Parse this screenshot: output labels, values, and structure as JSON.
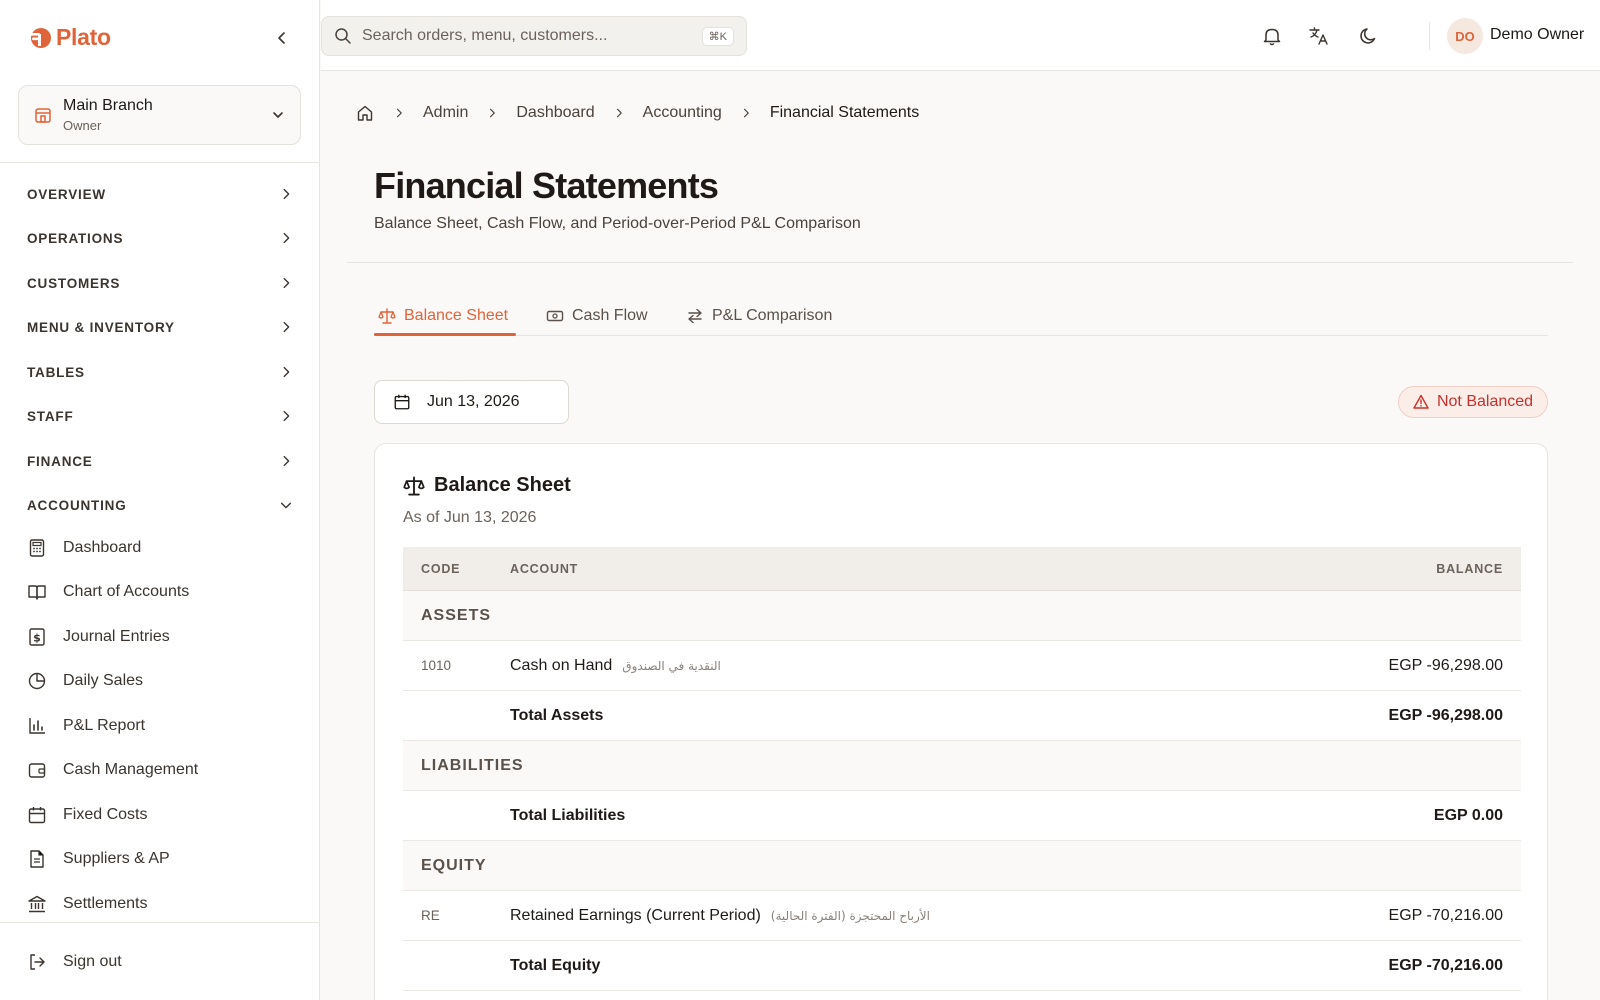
{
  "app": {
    "name": "Plato"
  },
  "branch": {
    "name": "Main Branch",
    "role": "Owner"
  },
  "sidebar": {
    "sections": [
      {
        "label": "OVERVIEW"
      },
      {
        "label": "OPERATIONS"
      },
      {
        "label": "CUSTOMERS"
      },
      {
        "label": "MENU & INVENTORY"
      },
      {
        "label": "TABLES"
      },
      {
        "label": "STAFF"
      },
      {
        "label": "FINANCE"
      },
      {
        "label": "ACCOUNTING",
        "expanded": true
      }
    ],
    "accounting_items": [
      {
        "label": "Dashboard",
        "icon": "calculator-icon"
      },
      {
        "label": "Chart of Accounts",
        "icon": "book-icon"
      },
      {
        "label": "Journal Entries",
        "icon": "dollar-doc-icon"
      },
      {
        "label": "Daily Sales",
        "icon": "pie-chart-icon"
      },
      {
        "label": "P&L Report",
        "icon": "bar-chart-icon"
      },
      {
        "label": "Cash Management",
        "icon": "wallet-icon"
      },
      {
        "label": "Fixed Costs",
        "icon": "calendar-icon"
      },
      {
        "label": "Suppliers & AP",
        "icon": "document-icon"
      },
      {
        "label": "Settlements",
        "icon": "bank-icon"
      }
    ],
    "signout": "Sign out"
  },
  "topbar": {
    "search_placeholder": "Search orders, menu, customers...",
    "shortcut": "⌘K",
    "user_initials": "DO",
    "user_name": "Demo Owner"
  },
  "breadcrumb": {
    "items": [
      "Admin",
      "Dashboard",
      "Accounting"
    ],
    "current": "Financial Statements"
  },
  "page": {
    "title": "Financial Statements",
    "subtitle": "Balance Sheet, Cash Flow, and Period-over-Period P&L Comparison"
  },
  "tabs": [
    {
      "label": "Balance Sheet",
      "active": true
    },
    {
      "label": "Cash Flow"
    },
    {
      "label": "P&L Comparison"
    }
  ],
  "date_picker": {
    "value": "Jun 13, 2026"
  },
  "status": {
    "label": "Not Balanced",
    "color": "#c9302c"
  },
  "card": {
    "title": "Balance Sheet",
    "subtitle": "As of Jun 13, 2026"
  },
  "table": {
    "columns": [
      "CODE",
      "ACCOUNT",
      "BALANCE"
    ],
    "assets": {
      "label": "ASSETS",
      "rows": [
        {
          "code": "1010",
          "account": "Cash on Hand",
          "account_ar": "النقدية في الصندوق",
          "balance": "EGP -96,298.00"
        }
      ],
      "total_label": "Total Assets",
      "total": "EGP -96,298.00"
    },
    "liabilities": {
      "label": "LIABILITIES",
      "total_label": "Total Liabilities",
      "total": "EGP 0.00"
    },
    "equity": {
      "label": "EQUITY",
      "rows": [
        {
          "code": "RE",
          "account": "Retained Earnings (Current Period)",
          "account_ar": "الأرباح المحتجزة (الفترة الحالية)",
          "balance": "EGP -70,216.00"
        }
      ],
      "total_label": "Total Equity",
      "total": "EGP -70,216.00"
    }
  },
  "colors": {
    "accent": "#e0643a",
    "danger": "#c9302c"
  }
}
